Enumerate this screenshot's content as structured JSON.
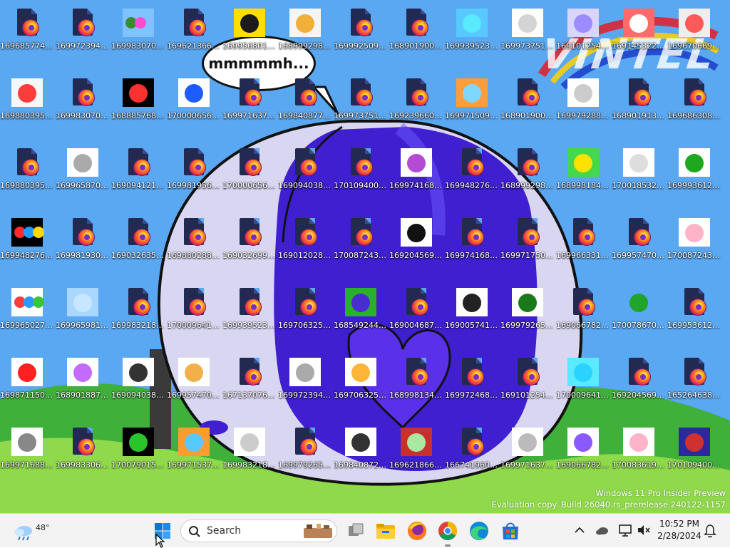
{
  "bubble_text": "mmmmmh...",
  "logo_text": "VINTEL",
  "watermark": {
    "line1": "Windows 11 Pro Insider Preview",
    "line2": "Evaluation copy. Build 26040.rs_prerelease.240122-1157"
  },
  "colors": {
    "sky": "#5aa7f2",
    "grass": "#3fb03a",
    "blob_dark": "#3f1fd0",
    "blob_light": "#d9d6f2",
    "taskbar": "#f3f3f3",
    "accent": "#0078d4"
  },
  "icons": [
    {
      "label": "1696857749...",
      "thumb": "firefox"
    },
    {
      "label": "1699723948...",
      "thumb": "firefox"
    },
    {
      "label": "1699830709...",
      "thumb": "colorful",
      "colors": [
        "#7ec3ff",
        "#3a8a2e",
        "#ff4ad2"
      ]
    },
    {
      "label": "1696213666...",
      "thumb": "firefox"
    },
    {
      "label": "1699568019...",
      "thumb": "colorful",
      "colors": [
        "#ffde00",
        "#1b1b1b"
      ]
    },
    {
      "label": "1689992981...",
      "thumb": "colorful",
      "colors": [
        "#f5f5f5",
        "#f0b03a"
      ]
    },
    {
      "label": "1699925093...",
      "thumb": "firefox"
    },
    {
      "label": "1689019000...",
      "thumb": "firefox"
    },
    {
      "label": "1699395236...",
      "thumb": "colorful",
      "colors": [
        "#58c9ff",
        "#58eaff"
      ]
    },
    {
      "label": "1699737515...",
      "thumb": "colorful",
      "colors": [
        "#ffffff",
        "#d4d4d4"
      ]
    },
    {
      "label": "1691012542...",
      "thumb": "colorful",
      "colors": [
        "#d8d6ff",
        "#9c8cff"
      ]
    },
    {
      "label": "1691453229...",
      "thumb": "colorful",
      "colors": [
        "#ff6b6b",
        "#ffffff"
      ]
    },
    {
      "label": "1696706694...",
      "thumb": "colorful",
      "colors": [
        "#eeeeee",
        "#ff5a5a"
      ]
    },
    {
      "label": "1698803957...",
      "thumb": "colorful",
      "colors": [
        "#f7f7f7",
        "#ff3b3b"
      ]
    },
    {
      "label": "1699830709...",
      "thumb": "firefox"
    },
    {
      "label": "1688857683...",
      "thumb": "colorful",
      "colors": [
        "#000000",
        "#ff3030"
      ]
    },
    {
      "label": "1700006560...",
      "thumb": "colorful",
      "colors": [
        "#ffffff",
        "#1d5cff"
      ]
    },
    {
      "label": "1699716374...",
      "thumb": "firefox"
    },
    {
      "label": "1698408771...",
      "thumb": "firefox"
    },
    {
      "label": "1699737515...",
      "thumb": "firefox"
    },
    {
      "label": "1692396601...",
      "thumb": "firefox"
    },
    {
      "label": "1699715097...",
      "thumb": "colorful",
      "colors": [
        "#ff9d3a",
        "#7fd6ff"
      ]
    },
    {
      "label": "1689019000...",
      "thumb": "firefox"
    },
    {
      "label": "1699792884...",
      "thumb": "colorful",
      "colors": [
        "#ffffff",
        "#cccccc"
      ]
    },
    {
      "label": "1689019138...",
      "thumb": "firefox"
    },
    {
      "label": "1696863082...",
      "thumb": "firefox"
    },
    {
      "label": "1698803957...",
      "thumb": "firefox"
    },
    {
      "label": "1699658700...",
      "thumb": "colorful",
      "colors": [
        "#ffffff",
        "#aaaaaa"
      ]
    },
    {
      "label": "1690941213...",
      "thumb": "firefox"
    },
    {
      "label": "1699819567...",
      "thumb": "firefox"
    },
    {
      "label": "1700006560...",
      "thumb": "firefox"
    },
    {
      "label": "1690940381...",
      "thumb": "firefox"
    },
    {
      "label": "1701094006...",
      "thumb": "firefox"
    },
    {
      "label": "1699741682...",
      "thumb": "colorful",
      "colors": [
        "#ffffff",
        "#b54ad4"
      ]
    },
    {
      "label": "1699482768...",
      "thumb": "firefox"
    },
    {
      "label": "1689992981...",
      "thumb": "firefox"
    },
    {
      "label": "1689981847...",
      "thumb": "colorful",
      "colors": [
        "#43d94a",
        "#ffe200"
      ]
    },
    {
      "label": "1700185321...",
      "thumb": "colorful",
      "colors": [
        "#ffffff",
        "#dddddd"
      ]
    },
    {
      "label": "1699936124...",
      "thumb": "colorful",
      "colors": [
        "#ffffff",
        "#1ea81e"
      ]
    },
    {
      "label": "1699482768...",
      "thumb": "colorful",
      "colors": [
        "#000000",
        "#ff2b2b",
        "#1e9bff",
        "#ffd800"
      ]
    },
    {
      "label": "1699819309...",
      "thumb": "firefox"
    },
    {
      "label": "1690326350...",
      "thumb": "firefox"
    },
    {
      "label": "1698802886...",
      "thumb": "firefox"
    },
    {
      "label": "1690326990...",
      "thumb": "firefox"
    },
    {
      "label": "1690120281...",
      "thumb": "firefox"
    },
    {
      "label": "1700872435...",
      "thumb": "firefox"
    },
    {
      "label": "1692045690...",
      "thumb": "colorful",
      "colors": [
        "#ffffff",
        "#111111"
      ]
    },
    {
      "label": "1699741682...",
      "thumb": "firefox"
    },
    {
      "label": "1699717507...",
      "thumb": "firefox"
    },
    {
      "label": "1699663312...",
      "thumb": "firefox"
    },
    {
      "label": "1699574709...",
      "thumb": "firefox"
    },
    {
      "label": "1700872435...",
      "thumb": "colorful",
      "colors": [
        "#ffffff",
        "#ffb3c8"
      ]
    },
    {
      "label": "1699650276...",
      "thumb": "colorful",
      "colors": [
        "#ffffff",
        "#ff3b3b",
        "#2b9bff",
        "#39c43a"
      ]
    },
    {
      "label": "1699659812...",
      "thumb": "colorful",
      "colors": [
        "#a9d7ff",
        "#c8e6ff"
      ]
    },
    {
      "label": "1699832183...",
      "thumb": "firefox"
    },
    {
      "label": "1700096414...",
      "thumb": "firefox"
    },
    {
      "label": "1699395236...",
      "thumb": "firefox"
    },
    {
      "label": "1697063258...",
      "thumb": "firefox"
    },
    {
      "label": "1685492447...",
      "thumb": "colorful",
      "colors": [
        "#2bb02b",
        "#4a2dd0"
      ]
    },
    {
      "label": "1690046878...",
      "thumb": "firefox"
    },
    {
      "label": "1690057411...",
      "thumb": "colorful",
      "colors": [
        "#ffffff",
        "#222222"
      ]
    },
    {
      "label": "1699792659...",
      "thumb": "colorful",
      "colors": [
        "#ffffff",
        "#1a7a1a"
      ]
    },
    {
      "label": "1690667822...",
      "thumb": "firefox"
    },
    {
      "label": "1700786703...",
      "thumb": "colorful",
      "colors": [
        "#5aa7f2",
        "#1fa52a"
      ]
    },
    {
      "label": "1699536124...",
      "thumb": "firefox"
    },
    {
      "label": "1698711504...",
      "thumb": "colorful",
      "colors": [
        "#ffffff",
        "#ff2020"
      ]
    },
    {
      "label": "1689018879...",
      "thumb": "colorful",
      "colors": [
        "#ffffff",
        "#c46bff"
      ]
    },
    {
      "label": "1690940381...",
      "thumb": "colorful",
      "colors": [
        "#ffffff",
        "#333333"
      ]
    },
    {
      "label": "1699574709...",
      "thumb": "colorful",
      "colors": [
        "#ffffff",
        "#f2b04a"
      ]
    },
    {
      "label": "1671370765...",
      "thumb": "firefox"
    },
    {
      "label": "1699723948...",
      "thumb": "colorful",
      "colors": [
        "#ffffff",
        "#aaaaaa"
      ]
    },
    {
      "label": "1697063258...",
      "thumb": "colorful",
      "colors": [
        "#ffffff",
        "#ffb43a"
      ]
    },
    {
      "label": "1689981347...",
      "thumb": "firefox"
    },
    {
      "label": "1699724686...",
      "thumb": "firefox"
    },
    {
      "label": "1691012542...",
      "thumb": "firefox"
    },
    {
      "label": "1700096414...",
      "thumb": "colorful",
      "colors": [
        "#58eaff",
        "#2ad3ff"
      ]
    },
    {
      "label": "1692045690...",
      "thumb": "firefox"
    },
    {
      "label": "1652646381...",
      "thumb": "firefox"
    },
    {
      "label": "1699716881...",
      "thumb": "colorful",
      "colors": [
        "#ffffff",
        "#888888"
      ]
    },
    {
      "label": "1699833067...",
      "thumb": "firefox"
    },
    {
      "label": "1700790152...",
      "thumb": "colorful",
      "colors": [
        "#000000",
        "#2bc42b"
      ]
    },
    {
      "label": "1699715378...",
      "thumb": "colorful",
      "colors": [
        "#ff9c30",
        "#58c9ff"
      ]
    },
    {
      "label": "1699832183...",
      "thumb": "colorful",
      "colors": [
        "#ffffff",
        "#cccccc"
      ]
    },
    {
      "label": "1699792659...",
      "thumb": "firefox"
    },
    {
      "label": "1698408721...",
      "thumb": "colorful",
      "colors": [
        "#ffffff",
        "#333333"
      ]
    },
    {
      "label": "1696218666...",
      "thumb": "colorful",
      "colors": [
        "#c83030",
        "#a8e8a0"
      ]
    },
    {
      "label": "1667419600...",
      "thumb": "firefox"
    },
    {
      "label": "1699716374...",
      "thumb": "colorful",
      "colors": [
        "#ffffff",
        "#bbbbbb"
      ]
    },
    {
      "label": "1690667822...",
      "thumb": "colorful",
      "colors": [
        "#ffffff",
        "#8b5aff"
      ]
    },
    {
      "label": "1700836197...",
      "thumb": "colorful",
      "colors": [
        "#ffffff",
        "#ffb3c8"
      ]
    },
    {
      "label": "1701094006...",
      "thumb": "colorful",
      "colors": [
        "#2a2aa0",
        "#cf3030"
      ]
    }
  ],
  "taskbar": {
    "weather_temp": "48°",
    "search_label": "Search",
    "apps": [
      "file-explorer",
      "firefox",
      "chrome",
      "edge",
      "microsoft-store"
    ],
    "time": "10:52 PM",
    "date": "2/28/2024"
  }
}
